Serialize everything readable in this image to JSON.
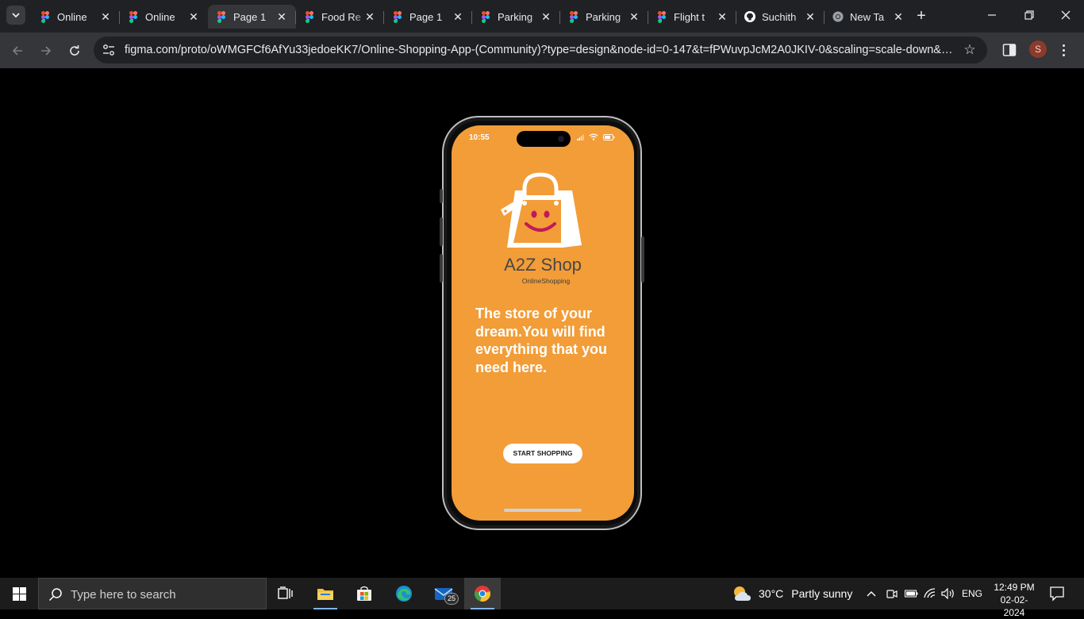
{
  "browser": {
    "tabs": [
      {
        "label": "Online",
        "favicon": "figma-icon",
        "active": false
      },
      {
        "label": "Online",
        "favicon": "figma-icon",
        "active": false
      },
      {
        "label": "Page 1",
        "favicon": "figma-icon",
        "active": true
      },
      {
        "label": "Food Re",
        "favicon": "figma-icon",
        "active": false
      },
      {
        "label": "Page 1",
        "favicon": "figma-icon",
        "active": false
      },
      {
        "label": "Parking",
        "favicon": "figma-icon",
        "active": false
      },
      {
        "label": "Parking",
        "favicon": "figma-icon",
        "active": false
      },
      {
        "label": "Flight t",
        "favicon": "figma-icon",
        "active": false
      },
      {
        "label": "Suchith",
        "favicon": "github-icon",
        "active": false
      },
      {
        "label": "New Ta",
        "favicon": "chrome-icon",
        "active": false
      }
    ],
    "url": "figma.com/proto/oWMGFCf6AfYu33jedoeKK7/Online-Shopping-App-(Community)?type=design&node-id=0-147&t=fPWuvpJcM2A0JKIV-0&scaling=scale-down&page...",
    "profile_initial": "S"
  },
  "app": {
    "status_time": "10:55",
    "brand_title": "A2Z Shop",
    "brand_subtitle": "OnlineShopping",
    "tagline": "The store of your dream.You will find everything that you need here.",
    "cta_label": "START SHOPPING",
    "colors": {
      "background": "#f29d38",
      "text": "#ffffff",
      "smile": "#c2185b"
    }
  },
  "taskbar": {
    "search_placeholder": "Type here to search",
    "mail_badge": "25",
    "weather_temp": "30°C",
    "weather_condition": "Partly sunny",
    "language": "ENG",
    "time": "12:49 PM",
    "date": "02-02-2024"
  }
}
